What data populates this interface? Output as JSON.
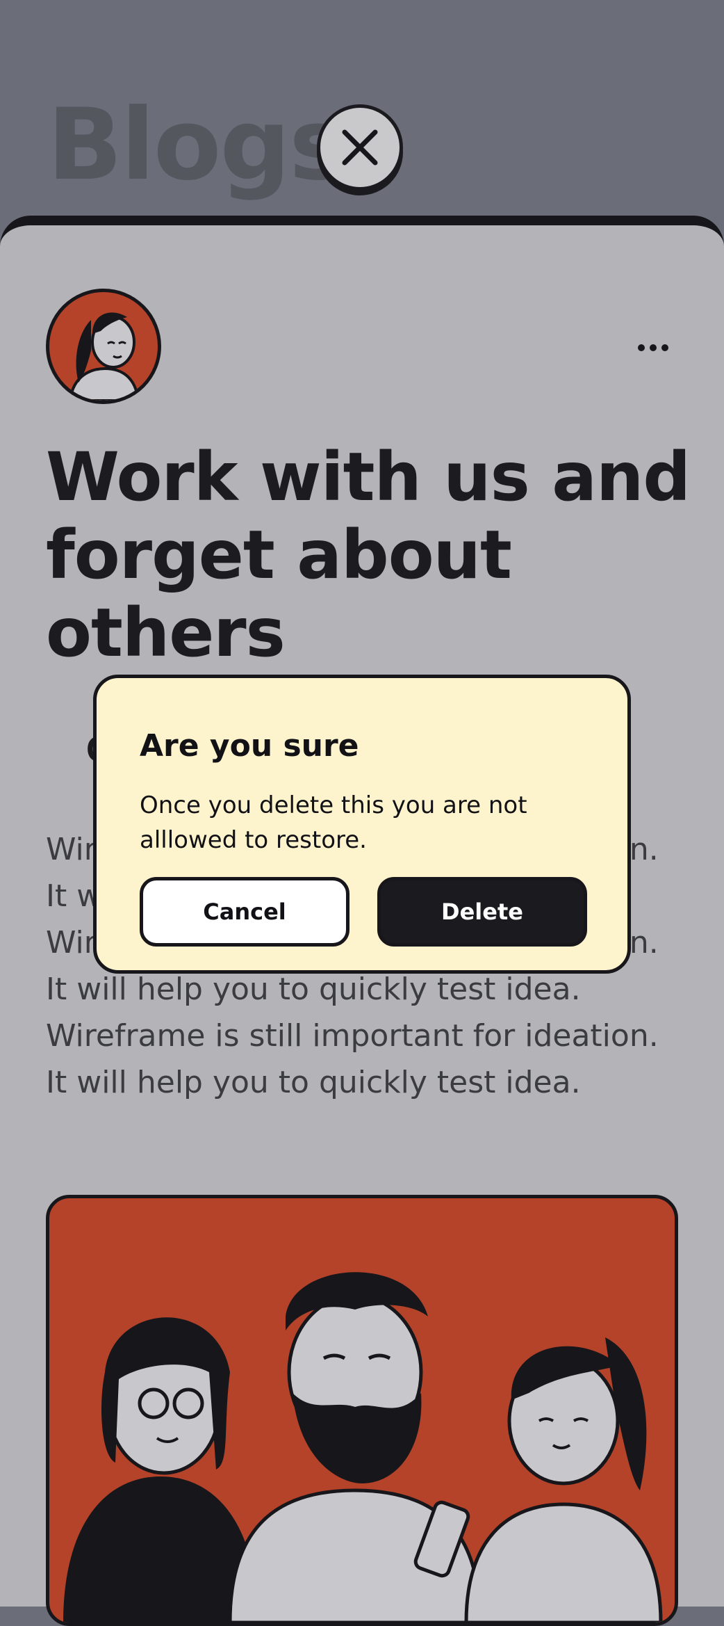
{
  "background": {
    "title": "Blogs"
  },
  "post": {
    "headline": "Work with us and forget about others",
    "body": "Wireframe is still important for ideation. It will help you to quickly test idea. Wireframe is still important for ideation. It will help you to quickly test idea. Wireframe is still important for ideation. It will help you to quickly test idea.",
    "partial_text": "C"
  },
  "dialog": {
    "title": "Are you sure",
    "message": "Once you delete this you are not alllowed to restore.",
    "cancel_label": "Cancel",
    "delete_label": "Delete"
  },
  "colors": {
    "overlay": "#6b6e79",
    "sheet": "#b4b4b8",
    "accent": "#b4432a",
    "dialog_bg": "#fdf3cd",
    "ink": "#17171b"
  },
  "icons": {
    "close": "close-icon",
    "more": "more-horizontal-icon"
  }
}
